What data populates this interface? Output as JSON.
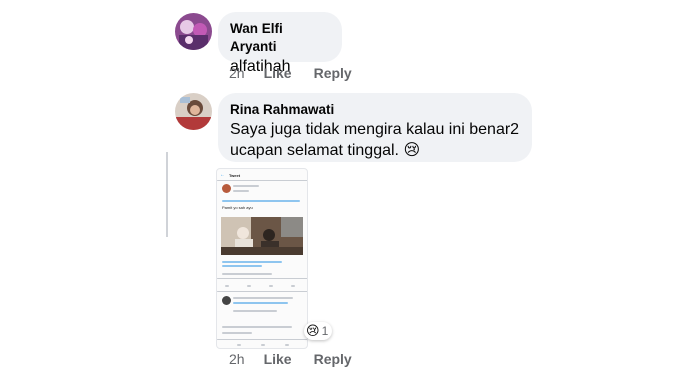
{
  "comments": [
    {
      "author": "Wan Elfi Aryanti",
      "text": "alfatihah",
      "time": "2h",
      "like_label": "Like",
      "reply_label": "Reply"
    },
    {
      "author": "Rina Rahmawati",
      "text_line1": "Saya juga tidak mengira kalau ini benar2",
      "text_line2": "ucapan selamat tinggal.",
      "emoji": "😢",
      "time": "2h",
      "like_label": "Like",
      "reply_label": "Reply",
      "reaction": {
        "icon": "sad-reaction-icon",
        "emoji": "😢",
        "count": "1"
      },
      "attachment": {
        "type": "tweet-screenshot",
        "header": "Tweet",
        "caption": "Pamit yo sah ayu"
      }
    }
  ],
  "colors": {
    "bubble_bg": "#f0f2f5",
    "meta_text": "#65676b",
    "text": "#050505"
  }
}
